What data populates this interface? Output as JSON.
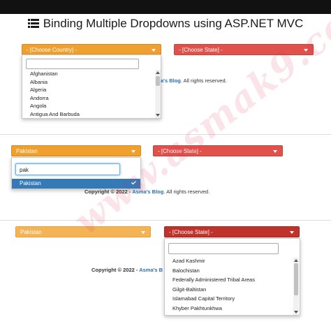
{
  "page": {
    "title": "Binding Multiple Dropdowns using ASP.NET MVC"
  },
  "colors": {
    "orange": "#f0a02e",
    "red": "#e0514b",
    "dark_red": "#c0332d",
    "selected_blue": "#337ab7",
    "link_blue": "#2a6fb0"
  },
  "icons": {
    "title": "list-icon",
    "caret": "caret-down-icon",
    "check": "check-icon"
  },
  "section1": {
    "country_dropdown": "- [Choose Country] -",
    "state_dropdown": "- [Choose State] -",
    "search_value": "",
    "options": [
      "Afghanistan",
      "Albania",
      "Algeria",
      "Andorra",
      "Angola",
      "Antigua And Barbuda"
    ],
    "footer": {
      "blog": "a's Blog",
      "rest": ". All rights reserved."
    }
  },
  "section2": {
    "country_dropdown": "Pakistan",
    "state_dropdown": "- [Choose State] -",
    "search_value": "pak",
    "selected_option": "Pakistan",
    "footer": {
      "copyright": "Copyright © 2022 - ",
      "blog": "Asma's Blog",
      "rest": ". All rights reserved."
    }
  },
  "section3": {
    "country_dropdown": "Pakistan",
    "state_dropdown": "- [Choose State] -",
    "search_value": "",
    "options": [
      "Azad Kashmir",
      "Balochistan",
      "Federally Administered Tribal Areas",
      "Gilgit-Baltistan",
      "Islamabad Capital Territory",
      "Khyber Pakhtunkhwa"
    ],
    "footer": {
      "copyright": "Copyright © 2022 - ",
      "blog": "Asma's B"
    }
  },
  "watermark": "www.asmak9.com"
}
